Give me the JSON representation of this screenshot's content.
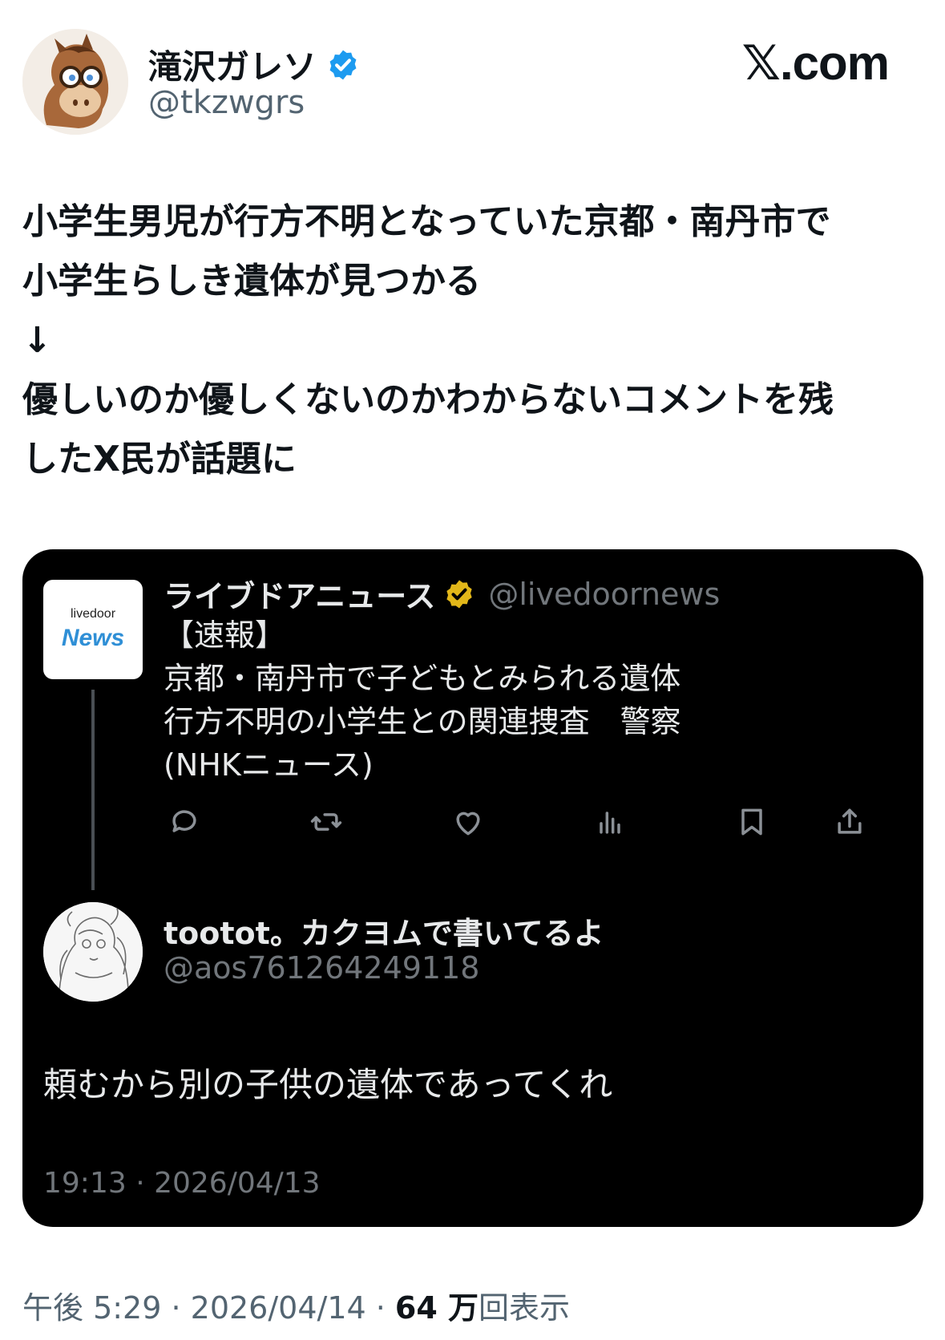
{
  "author": {
    "name": "滝沢ガレソ",
    "handle": "@tkzwgrs",
    "verified": true,
    "avatar_icon": "horse-mascot-avatar"
  },
  "site_logo": "𝕏.com",
  "tweet": {
    "text": "小学生男児が行方不明となっていた京都・南丹市で\n小学生らしき遺体が見つかる\n↓\n優しいのか優しくないのかわからないコメントを残\nしたX民が話題に"
  },
  "quoted": {
    "original": {
      "name": "ライブドアニュース",
      "handle": "@livedoornews",
      "badge": "gold-verified",
      "logo_small": "livedoor",
      "logo_big": "News",
      "text": "【速報】\n京都・南丹市で子どもとみられる遺体\n行方不明の小学生との関連捜査　警察\n(NHKニュース)",
      "actions": [
        "reply-icon",
        "repost-icon",
        "like-icon",
        "views-icon",
        "bookmark-icon",
        "share-icon"
      ]
    },
    "reply": {
      "name": "tootot。カクヨムで書いてるよ",
      "handle": "@aos761264249118",
      "avatar_icon": "manga-sketch-avatar",
      "text": "頼むから別の子供の遺体であってくれ",
      "time": "19:13 · 2026/04/13"
    }
  },
  "footer": {
    "time": "午後 5:29 · 2026/04/14 · ",
    "views_num": "64 万",
    "views_label": "回表示"
  },
  "colors": {
    "verified_blue": "#1d9bf0",
    "verified_gold": "#e2b719",
    "card_bg": "#000000",
    "muted": "#71767b"
  }
}
